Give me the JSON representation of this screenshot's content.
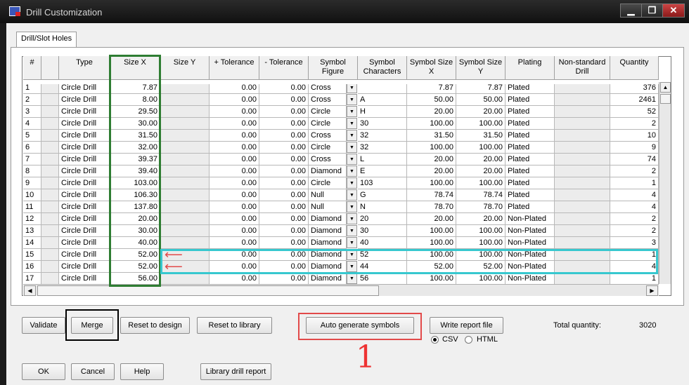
{
  "window": {
    "title": "Drill Customization",
    "controls": [
      "▁",
      "❐",
      "✕"
    ]
  },
  "tab": {
    "label": "Drill/Slot Holes"
  },
  "columns": [
    {
      "key": "num",
      "label": "#"
    },
    {
      "key": "blank",
      "label": ""
    },
    {
      "key": "type",
      "label": "Type"
    },
    {
      "key": "size_x",
      "label": "Size X"
    },
    {
      "key": "size_y",
      "label": "Size Y"
    },
    {
      "key": "plus_tol",
      "label": "+ Tolerance"
    },
    {
      "key": "minus_tol",
      "label": "- Tolerance"
    },
    {
      "key": "sym_fig",
      "label": "Symbol Figure"
    },
    {
      "key": "sym_chars",
      "label": "Symbol Characters"
    },
    {
      "key": "sym_size_x",
      "label": "Symbol Size X"
    },
    {
      "key": "sym_size_y",
      "label": "Symbol Size Y"
    },
    {
      "key": "plating",
      "label": "Plating"
    },
    {
      "key": "nonstd",
      "label": "Non-standard Drill"
    },
    {
      "key": "qty",
      "label": "Quantity"
    }
  ],
  "rows": [
    {
      "num": "1",
      "type": "Circle Drill",
      "size_x": "7.87",
      "plus_tol": "0.00",
      "minus_tol": "0.00",
      "sym_fig": "Cross",
      "sym_chars": "",
      "sym_size_x": "7.87",
      "sym_size_y": "7.87",
      "plating": "Plated",
      "qty": "376"
    },
    {
      "num": "2",
      "type": "Circle Drill",
      "size_x": "8.00",
      "plus_tol": "0.00",
      "minus_tol": "0.00",
      "sym_fig": "Cross",
      "sym_chars": "A",
      "sym_size_x": "50.00",
      "sym_size_y": "50.00",
      "plating": "Plated",
      "qty": "2461"
    },
    {
      "num": "3",
      "type": "Circle Drill",
      "size_x": "29.50",
      "plus_tol": "0.00",
      "minus_tol": "0.00",
      "sym_fig": "Circle",
      "sym_chars": "H",
      "sym_size_x": "20.00",
      "sym_size_y": "20.00",
      "plating": "Plated",
      "qty": "52"
    },
    {
      "num": "4",
      "type": "Circle Drill",
      "size_x": "30.00",
      "plus_tol": "0.00",
      "minus_tol": "0.00",
      "sym_fig": "Circle",
      "sym_chars": "30",
      "sym_size_x": "100.00",
      "sym_size_y": "100.00",
      "plating": "Plated",
      "qty": "2"
    },
    {
      "num": "5",
      "type": "Circle Drill",
      "size_x": "31.50",
      "plus_tol": "0.00",
      "minus_tol": "0.00",
      "sym_fig": "Cross",
      "sym_chars": "32",
      "sym_size_x": "31.50",
      "sym_size_y": "31.50",
      "plating": "Plated",
      "qty": "10"
    },
    {
      "num": "6",
      "type": "Circle Drill",
      "size_x": "32.00",
      "plus_tol": "0.00",
      "minus_tol": "0.00",
      "sym_fig": "Circle",
      "sym_chars": "32",
      "sym_size_x": "100.00",
      "sym_size_y": "100.00",
      "plating": "Plated",
      "qty": "9"
    },
    {
      "num": "7",
      "type": "Circle Drill",
      "size_x": "39.37",
      "plus_tol": "0.00",
      "minus_tol": "0.00",
      "sym_fig": "Cross",
      "sym_chars": "L",
      "sym_size_x": "20.00",
      "sym_size_y": "20.00",
      "plating": "Plated",
      "qty": "74"
    },
    {
      "num": "8",
      "type": "Circle Drill",
      "size_x": "39.40",
      "plus_tol": "0.00",
      "minus_tol": "0.00",
      "sym_fig": "Diamond",
      "sym_chars": "E",
      "sym_size_x": "20.00",
      "sym_size_y": "20.00",
      "plating": "Plated",
      "qty": "2"
    },
    {
      "num": "9",
      "type": "Circle Drill",
      "size_x": "103.00",
      "plus_tol": "0.00",
      "minus_tol": "0.00",
      "sym_fig": "Circle",
      "sym_chars": "103",
      "sym_size_x": "100.00",
      "sym_size_y": "100.00",
      "plating": "Plated",
      "qty": "1"
    },
    {
      "num": "10",
      "type": "Circle Drill",
      "size_x": "106.30",
      "plus_tol": "0.00",
      "minus_tol": "0.00",
      "sym_fig": "Null",
      "sym_chars": "G",
      "sym_size_x": "78.74",
      "sym_size_y": "78.74",
      "plating": "Plated",
      "qty": "4"
    },
    {
      "num": "11",
      "type": "Circle Drill",
      "size_x": "137.80",
      "plus_tol": "0.00",
      "minus_tol": "0.00",
      "sym_fig": "Null",
      "sym_chars": "N",
      "sym_size_x": "78.70",
      "sym_size_y": "78.70",
      "plating": "Plated",
      "qty": "4"
    },
    {
      "num": "12",
      "type": "Circle Drill",
      "size_x": "20.00",
      "plus_tol": "0.00",
      "minus_tol": "0.00",
      "sym_fig": "Diamond",
      "sym_chars": "20",
      "sym_size_x": "20.00",
      "sym_size_y": "20.00",
      "plating": "Non-Plated",
      "qty": "2"
    },
    {
      "num": "13",
      "type": "Circle Drill",
      "size_x": "30.00",
      "plus_tol": "0.00",
      "minus_tol": "0.00",
      "sym_fig": "Diamond",
      "sym_chars": "30",
      "sym_size_x": "100.00",
      "sym_size_y": "100.00",
      "plating": "Non-Plated",
      "qty": "2"
    },
    {
      "num": "14",
      "type": "Circle Drill",
      "size_x": "40.00",
      "plus_tol": "0.00",
      "minus_tol": "0.00",
      "sym_fig": "Diamond",
      "sym_chars": "40",
      "sym_size_x": "100.00",
      "sym_size_y": "100.00",
      "plating": "Non-Plated",
      "qty": "3"
    },
    {
      "num": "15",
      "type": "Circle Drill",
      "size_x": "52.00",
      "plus_tol": "0.00",
      "minus_tol": "0.00",
      "sym_fig": "Diamond",
      "sym_chars": "52",
      "sym_size_x": "100.00",
      "sym_size_y": "100.00",
      "plating": "Non-Plated",
      "qty": "1"
    },
    {
      "num": "16",
      "type": "Circle Drill",
      "size_x": "52.00",
      "plus_tol": "0.00",
      "minus_tol": "0.00",
      "sym_fig": "Diamond",
      "sym_chars": "44",
      "sym_size_x": "52.00",
      "sym_size_y": "52.00",
      "plating": "Non-Plated",
      "qty": "4"
    },
    {
      "num": "17",
      "type": "Circle Drill",
      "size_x": "56.00",
      "plus_tol": "0.00",
      "minus_tol": "0.00",
      "sym_fig": "Diamond",
      "sym_chars": "56",
      "sym_size_x": "100.00",
      "sym_size_y": "100.00",
      "plating": "Non-Plated",
      "qty": "1"
    }
  ],
  "buttons": {
    "validate": "Validate",
    "merge": "Merge",
    "reset_design": "Reset to design",
    "reset_library": "Reset to library",
    "auto_generate": "Auto generate symbols",
    "write_report": "Write report file",
    "ok": "OK",
    "cancel": "Cancel",
    "help": "Help",
    "library_report": "Library drill report"
  },
  "report_format": {
    "csv": "CSV",
    "html": "HTML",
    "selected": "CSV"
  },
  "total": {
    "label": "Total quantity:",
    "value": "3020"
  },
  "annotation": {
    "step_number": "1",
    "arrow_glyph": "⟵"
  },
  "scroll_glyphs": {
    "left": "◀",
    "right": "▶",
    "up": "▲",
    "down": "▼",
    "dropdown": "▼"
  },
  "colors": {
    "green_box": "#2e7d32",
    "cyan_box": "#37c8cf",
    "red_annotation": "#e24a4a",
    "black_box": "#000000"
  }
}
